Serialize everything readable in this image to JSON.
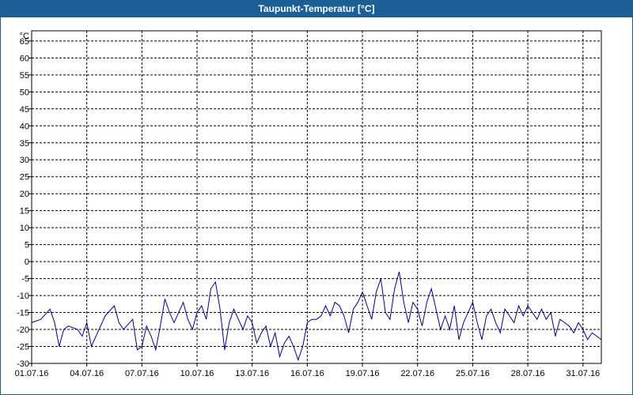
{
  "chart_data": {
    "type": "line",
    "title": "Taupunkt-Temperatur [°C]",
    "unit": "°C",
    "ylim": [
      -30,
      68
    ],
    "y_ticks": [
      65,
      60,
      55,
      50,
      45,
      40,
      35,
      30,
      25,
      20,
      15,
      10,
      5,
      0,
      -5,
      -10,
      -15,
      -20,
      -25,
      -30
    ],
    "x_range": [
      "01.07.16",
      "01.08.16"
    ],
    "x_ticks": [
      "01.07.16",
      "04.07.16",
      "07.07.16",
      "10.07.16",
      "13.07.16",
      "16.07.16",
      "19.07.16",
      "22.07.16",
      "25.07.16",
      "28.07.16",
      "31.07.16"
    ],
    "grid": true,
    "series": [
      {
        "color": "#00008b",
        "points": [
          [
            "01.07.16 00:00",
            -18
          ],
          [
            "01.07.16 12:00",
            -17
          ],
          [
            "02.07.16 00:00",
            -14
          ],
          [
            "02.07.16 06:00",
            -18
          ],
          [
            "02.07.16 12:00",
            -25
          ],
          [
            "02.07.16 18:00",
            -20
          ],
          [
            "03.07.16 00:00",
            -19
          ],
          [
            "03.07.16 12:00",
            -20
          ],
          [
            "03.07.16 18:00",
            -22
          ],
          [
            "04.07.16 00:00",
            -18
          ],
          [
            "04.07.16 06:00",
            -25
          ],
          [
            "04.07.16 18:00",
            -19
          ],
          [
            "05.07.16 00:00",
            -16
          ],
          [
            "05.07.16 12:00",
            -13
          ],
          [
            "05.07.16 18:00",
            -18
          ],
          [
            "06.07.16 00:00",
            -20
          ],
          [
            "06.07.16 12:00",
            -17
          ],
          [
            "06.07.16 18:00",
            -26
          ],
          [
            "07.07.16 00:00",
            -25
          ],
          [
            "07.07.16 06:00",
            -19
          ],
          [
            "07.07.16 12:00",
            -22
          ],
          [
            "07.07.16 18:00",
            -26
          ],
          [
            "08.07.16 00:00",
            -19
          ],
          [
            "08.07.16 06:00",
            -11
          ],
          [
            "08.07.16 12:00",
            -15
          ],
          [
            "08.07.16 18:00",
            -18
          ],
          [
            "09.07.16 00:00",
            -15
          ],
          [
            "09.07.16 06:00",
            -12
          ],
          [
            "09.07.16 12:00",
            -17
          ],
          [
            "09.07.16 18:00",
            -20
          ],
          [
            "10.07.16 00:00",
            -15
          ],
          [
            "10.07.16 06:00",
            -13
          ],
          [
            "10.07.16 12:00",
            -17
          ],
          [
            "10.07.16 18:00",
            -8
          ],
          [
            "11.07.16 00:00",
            -6
          ],
          [
            "11.07.16 06:00",
            -14
          ],
          [
            "11.07.16 12:00",
            -26
          ],
          [
            "11.07.16 18:00",
            -18
          ],
          [
            "12.07.16 00:00",
            -14
          ],
          [
            "12.07.16 06:00",
            -17
          ],
          [
            "12.07.16 12:00",
            -20
          ],
          [
            "12.07.16 18:00",
            -16
          ],
          [
            "13.07.16 00:00",
            -18
          ],
          [
            "13.07.16 06:00",
            -24
          ],
          [
            "13.07.16 12:00",
            -21
          ],
          [
            "13.07.16 18:00",
            -19
          ],
          [
            "14.07.16 00:00",
            -25
          ],
          [
            "14.07.16 06:00",
            -21
          ],
          [
            "14.07.16 12:00",
            -28
          ],
          [
            "14.07.16 18:00",
            -24
          ],
          [
            "15.07.16 00:00",
            -22
          ],
          [
            "15.07.16 06:00",
            -25
          ],
          [
            "15.07.16 12:00",
            -29
          ],
          [
            "15.07.16 18:00",
            -25
          ],
          [
            "16.07.16 00:00",
            -18
          ],
          [
            "16.07.16 06:00",
            -17
          ],
          [
            "16.07.16 12:00",
            -17
          ],
          [
            "16.07.16 18:00",
            -16
          ],
          [
            "17.07.16 00:00",
            -13
          ],
          [
            "17.07.16 06:00",
            -16
          ],
          [
            "17.07.16 12:00",
            -12
          ],
          [
            "17.07.16 18:00",
            -13
          ],
          [
            "18.07.16 00:00",
            -16
          ],
          [
            "18.07.16 06:00",
            -21
          ],
          [
            "18.07.16 12:00",
            -14
          ],
          [
            "18.07.16 18:00",
            -12
          ],
          [
            "19.07.16 00:00",
            -9
          ],
          [
            "19.07.16 06:00",
            -13
          ],
          [
            "19.07.16 12:00",
            -17
          ],
          [
            "19.07.16 18:00",
            -9
          ],
          [
            "20.07.16 00:00",
            -5
          ],
          [
            "20.07.16 06:00",
            -15
          ],
          [
            "20.07.16 12:00",
            -17
          ],
          [
            "20.07.16 18:00",
            -8
          ],
          [
            "21.07.16 00:00",
            -3
          ],
          [
            "21.07.16 06:00",
            -12
          ],
          [
            "21.07.16 12:00",
            -18
          ],
          [
            "21.07.16 18:00",
            -12
          ],
          [
            "22.07.16 00:00",
            -14
          ],
          [
            "22.07.16 06:00",
            -19
          ],
          [
            "22.07.16 12:00",
            -12
          ],
          [
            "22.07.16 18:00",
            -8
          ],
          [
            "23.07.16 00:00",
            -14
          ],
          [
            "23.07.16 06:00",
            -20
          ],
          [
            "23.07.16 12:00",
            -16
          ],
          [
            "23.07.16 18:00",
            -20
          ],
          [
            "24.07.16 00:00",
            -13
          ],
          [
            "24.07.16 06:00",
            -23
          ],
          [
            "24.07.16 12:00",
            -18
          ],
          [
            "24.07.16 18:00",
            -15
          ],
          [
            "25.07.16 00:00",
            -12
          ],
          [
            "25.07.16 06:00",
            -18
          ],
          [
            "25.07.16 12:00",
            -23
          ],
          [
            "25.07.16 18:00",
            -16
          ],
          [
            "26.07.16 00:00",
            -14
          ],
          [
            "26.07.16 06:00",
            -18
          ],
          [
            "26.07.16 12:00",
            -21
          ],
          [
            "26.07.16 18:00",
            -14
          ],
          [
            "27.07.16 00:00",
            -16
          ],
          [
            "27.07.16 06:00",
            -18
          ],
          [
            "27.07.16 12:00",
            -13
          ],
          [
            "27.07.16 18:00",
            -16
          ],
          [
            "28.07.16 00:00",
            -13
          ],
          [
            "28.07.16 06:00",
            -15
          ],
          [
            "28.07.16 12:00",
            -17
          ],
          [
            "28.07.16 18:00",
            -14
          ],
          [
            "29.07.16 00:00",
            -17
          ],
          [
            "29.07.16 06:00",
            -15
          ],
          [
            "29.07.16 12:00",
            -22
          ],
          [
            "29.07.16 18:00",
            -17
          ],
          [
            "30.07.16 00:00",
            -18
          ],
          [
            "30.07.16 06:00",
            -19
          ],
          [
            "30.07.16 12:00",
            -21
          ],
          [
            "30.07.16 18:00",
            -18
          ],
          [
            "31.07.16 00:00",
            -20
          ],
          [
            "31.07.16 06:00",
            -23
          ],
          [
            "31.07.16 12:00",
            -21
          ],
          [
            "31.07.16 18:00",
            -22
          ],
          [
            "01.08.16 00:00",
            -23
          ]
        ]
      }
    ]
  }
}
